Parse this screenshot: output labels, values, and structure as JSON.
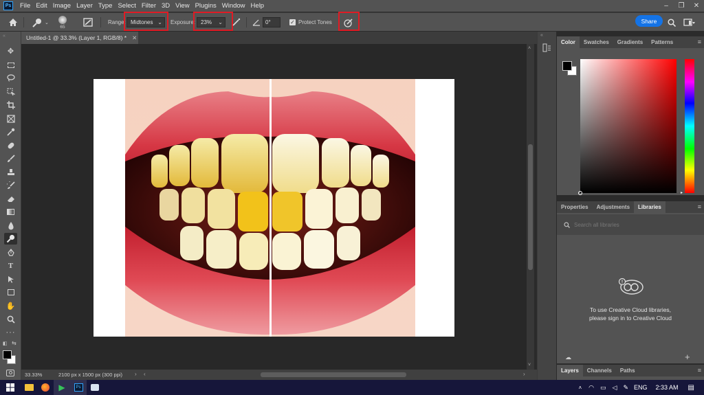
{
  "menu": [
    "File",
    "Edit",
    "Image",
    "Layer",
    "Type",
    "Select",
    "Filter",
    "3D",
    "View",
    "Plugins",
    "Window",
    "Help"
  ],
  "app_logo": "Ps",
  "options": {
    "brush_size": "65",
    "range_label": "Range:",
    "range_value": "Midtones",
    "exposure_label": "Exposure:",
    "exposure_value": "23%",
    "angle_value": "0°",
    "protect_tones_label": "Protect Tones",
    "protect_tones_checked": true,
    "share_label": "Share"
  },
  "document": {
    "tab_title": "Untitled-1 @ 33.3% (Layer 1, RGB/8) *",
    "zoom": "33.33%",
    "size_info": "2100 px x 1500 px (300 ppi)"
  },
  "tools": [
    "move-tool",
    "marquee-tool",
    "lasso-tool",
    "object-select-tool",
    "crop-tool",
    "frame-tool",
    "eyedropper-tool",
    "healing-brush-tool",
    "brush-tool",
    "clone-stamp-tool",
    "history-brush-tool",
    "eraser-tool",
    "gradient-tool",
    "blur-tool",
    "dodge-tool",
    "pen-tool",
    "type-tool",
    "path-select-tool",
    "rectangle-tool",
    "hand-tool",
    "zoom-tool",
    "more-tools"
  ],
  "color_panel": {
    "tabs": [
      "Color",
      "Swatches",
      "Gradients",
      "Patterns"
    ],
    "active": "Color",
    "foreground": "#000000",
    "background": "#ffffff"
  },
  "libraries_panel": {
    "tabs": [
      "Properties",
      "Adjustments",
      "Libraries"
    ],
    "active": "Libraries",
    "search_placeholder": "Search all libraries",
    "message_line1": "To use Creative Cloud libraries,",
    "message_line2": "please sign in to Creative Cloud"
  },
  "layers_panel": {
    "tabs": [
      "Layers",
      "Channels",
      "Paths"
    ],
    "active": "Layers"
  },
  "taskbar": {
    "language": "ENG",
    "time": "2:33 AM"
  },
  "colors": {
    "highlight": "#e01b24",
    "accent": "#1473e6"
  }
}
